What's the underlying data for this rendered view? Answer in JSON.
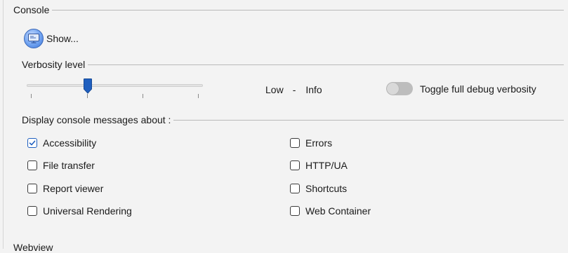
{
  "console_group": {
    "title": "Console",
    "show_button_label": "Show...",
    "verbosity": {
      "title": "Verbosity level",
      "level_min_label": "Low",
      "separator": "-",
      "level_current_label": "Info",
      "slider_value_fraction": 0.34,
      "tick_count": 4
    },
    "debug_toggle": {
      "label": "Toggle full debug verbosity",
      "on": false
    },
    "messages": {
      "title": "Display console messages about :",
      "left_column": [
        {
          "label": "Accessibility",
          "checked": true
        },
        {
          "label": "File transfer",
          "checked": false
        },
        {
          "label": "Report viewer",
          "checked": false
        },
        {
          "label": "Universal Rendering",
          "checked": false
        }
      ],
      "right_column": [
        {
          "label": "Errors",
          "checked": false
        },
        {
          "label": "HTTP/UA",
          "checked": false
        },
        {
          "label": "Shortcuts",
          "checked": false
        },
        {
          "label": "Web Container",
          "checked": false
        }
      ]
    }
  },
  "next_group": {
    "title": "Webview"
  },
  "colors": {
    "background": "#f3f3f3",
    "accent": "#1f5fbf",
    "checkmark": "#1f5fbf",
    "slider_thumb": "#1f5fbf"
  },
  "icons": {
    "show_button": "monitor-console-icon",
    "checkbox_checked": "checkmark-icon"
  }
}
